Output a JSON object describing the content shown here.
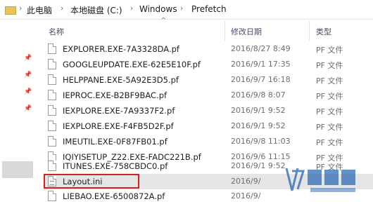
{
  "address": {
    "segments": [
      "此电脑",
      "本地磁盘 (C:)",
      "Windows",
      "Prefetch"
    ],
    "separator": "›"
  },
  "columns": {
    "name": "名称",
    "modified": "修改日期",
    "type": "类型"
  },
  "files": [
    {
      "name": "EXPLORER.EXE-7A3328DA.pf",
      "modified": "2016/8/27 8:49",
      "type": "PF 文件",
      "icon": "file-icon"
    },
    {
      "name": "GOOGLEUPDATE.EXE-62E5E10F.pf",
      "modified": "2016/9/1 17:35",
      "type": "PF 文件",
      "icon": "file-icon"
    },
    {
      "name": "HELPPANE.EXE-5A92E3D5.pf",
      "modified": "2016/9/7 16:18",
      "type": "PF 文件",
      "icon": "file-icon"
    },
    {
      "name": "IEPROC.EXE-B2BF9BAC.pf",
      "modified": "2016/9/8 8:07",
      "type": "PF 文件",
      "icon": "file-icon"
    },
    {
      "name": "IEXPLORE.EXE-7A9337F2.pf",
      "modified": "2016/9/1 9:52",
      "type": "PF 文件",
      "icon": "file-icon"
    },
    {
      "name": "IEXPLORE.EXE-F4FB5D2F.pf",
      "modified": "2016/9/1 9:52",
      "type": "PF 文件",
      "icon": "file-icon"
    },
    {
      "name": "IMEUTIL.EXE-0F87FB01.pf",
      "modified": "2016/9/8 11:03",
      "type": "PF 文件",
      "icon": "file-icon"
    },
    {
      "name": "IQIYISETUP_Z22.EXE-FADC221B.pf",
      "modified": "2016/9/6 11:15",
      "type": "PF 文件",
      "icon": "file-icon"
    },
    {
      "name": "ITUNES.EXE-758CBDC0.pf",
      "modified": "2016/9/1 9:52",
      "type": "PF 文件",
      "icon": "file-icon"
    },
    {
      "name": "Layout.ini",
      "modified": "2016/9/",
      "type": "",
      "icon": "ini-file-icon",
      "selected": true
    },
    {
      "name": "LIEBAO.EXE-6500872A.pf",
      "modified": "2016/9/",
      "type": "",
      "icon": "file-icon"
    }
  ],
  "colors": {
    "highlight_border": "#d81e1e",
    "selected_row": "#e5e5e5",
    "nav_selected": "#d9d9d9",
    "watermark": "#2f6db5"
  }
}
